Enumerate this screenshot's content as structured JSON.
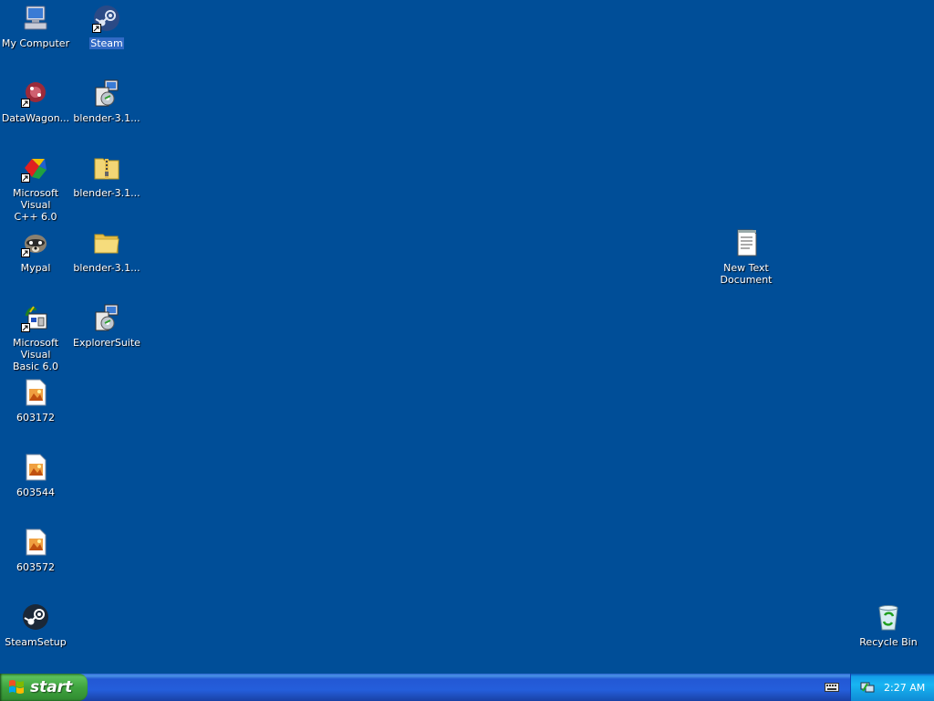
{
  "desktop": {
    "icons": [
      {
        "label": "My Computer",
        "icon": "my-computer-icon"
      },
      {
        "label": "Steam",
        "icon": "steam-icon",
        "selected": true
      },
      {
        "label": "DataWagon...",
        "icon": "datawagon-icon"
      },
      {
        "label": "blender-3.1...",
        "icon": "installer-icon"
      },
      {
        "label": "Microsoft Visual\nC++ 6.0",
        "icon": "visual-cpp-icon"
      },
      {
        "label": "blender-3.1...",
        "icon": "zip-folder-icon"
      },
      {
        "label": "Mypal",
        "icon": "mypal-icon"
      },
      {
        "label": "blender-3.1...",
        "icon": "folder-icon"
      },
      {
        "label": "Microsoft Visual\nBasic 6.0",
        "icon": "visual-basic-icon"
      },
      {
        "label": "ExplorerSuite",
        "icon": "installer-icon"
      },
      {
        "label": "603172",
        "icon": "image-file-icon"
      },
      {
        "label": "603544",
        "icon": "image-file-icon"
      },
      {
        "label": "603572",
        "icon": "image-file-icon"
      },
      {
        "label": "SteamSetup",
        "icon": "steam-icon"
      },
      {
        "label": "New Text\nDocument",
        "icon": "text-document-icon"
      },
      {
        "label": "Recycle Bin",
        "icon": "recycle-bin-icon"
      }
    ]
  },
  "taskbar": {
    "start_label": "start",
    "clock": "2:27 AM"
  },
  "colors": {
    "desktop_background": "#004e98",
    "taskbar": "#245edb",
    "start_button": "#3fa43f",
    "tray": "#18b5f2"
  }
}
